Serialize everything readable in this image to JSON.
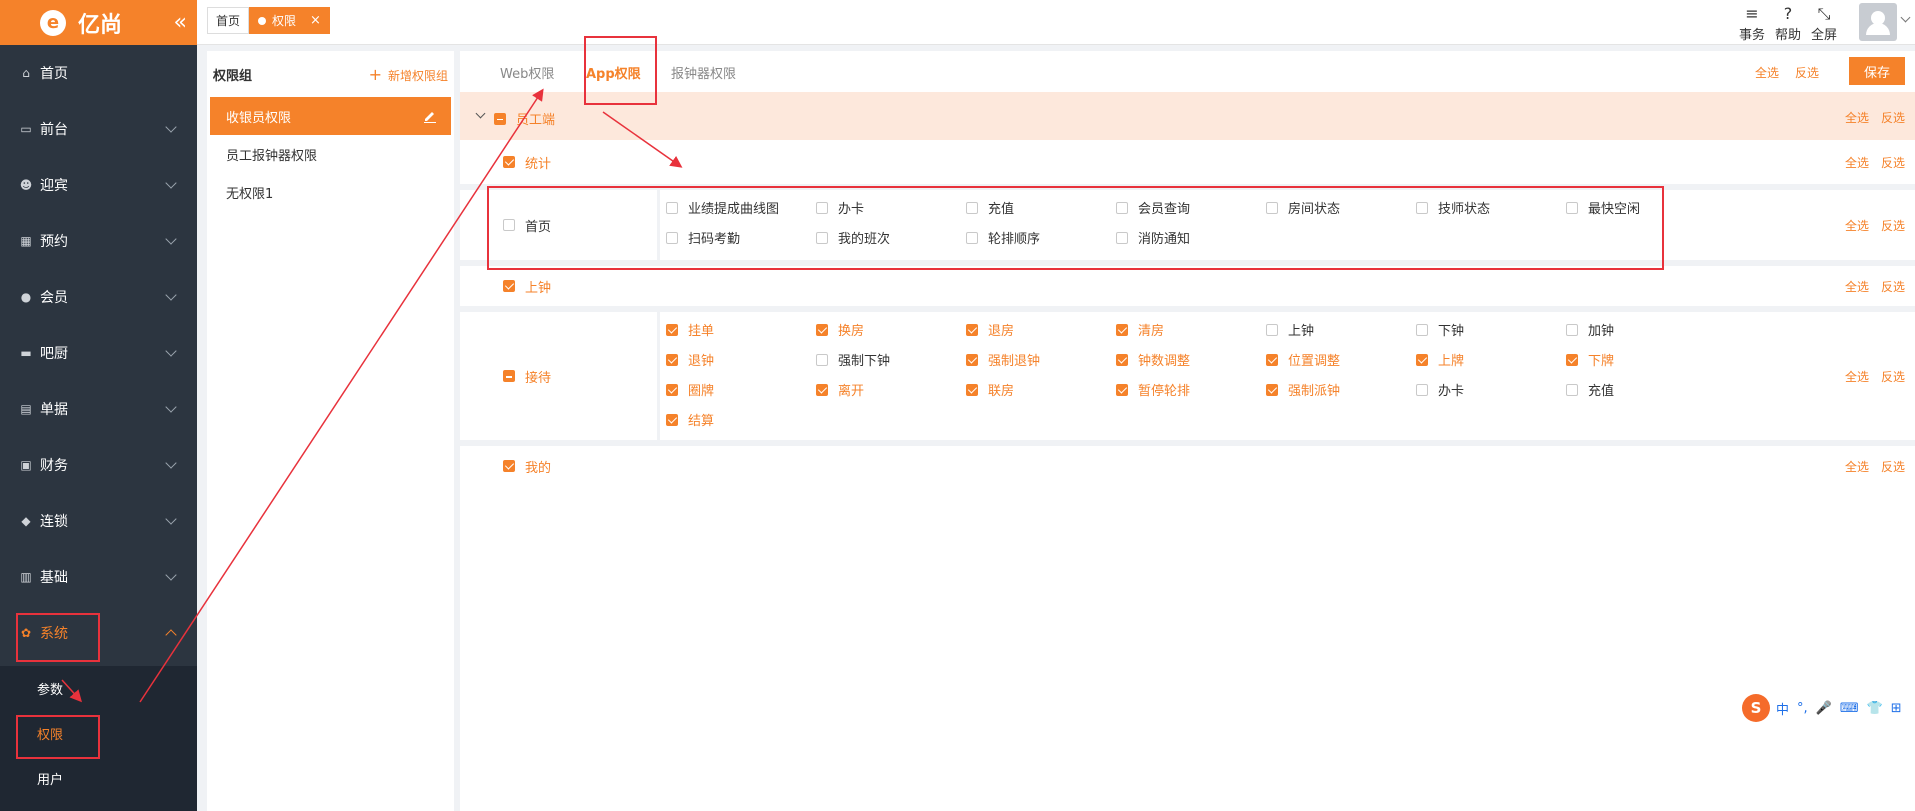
{
  "brand": {
    "name": "亿尚",
    "logo_letter": "e",
    "accent": "#f5822a"
  },
  "sidebar": {
    "items": [
      {
        "label": "首页",
        "icon": "home-icon",
        "glyph": "⌂"
      },
      {
        "label": "前台",
        "icon": "monitor-icon",
        "glyph": "▭"
      },
      {
        "label": "迎宾",
        "icon": "person-icon",
        "glyph": "☻"
      },
      {
        "label": "预约",
        "icon": "calendar-icon",
        "glyph": "▦"
      },
      {
        "label": "会员",
        "icon": "user-icon",
        "glyph": "●"
      },
      {
        "label": "吧厨",
        "icon": "bar-icon",
        "glyph": "▬"
      },
      {
        "label": "单据",
        "icon": "clipboard-icon",
        "glyph": "▤"
      },
      {
        "label": "财务",
        "icon": "finance-icon",
        "glyph": "▣"
      },
      {
        "label": "连锁",
        "icon": "cube-icon",
        "glyph": "◆"
      },
      {
        "label": "基础",
        "icon": "base-icon",
        "glyph": "▥"
      },
      {
        "label": "系统",
        "icon": "gear-icon",
        "glyph": "✿"
      }
    ],
    "sub_items": [
      {
        "label": "参数"
      },
      {
        "label": "权限"
      },
      {
        "label": "用户"
      }
    ]
  },
  "header": {
    "tabs": [
      {
        "label": "首页"
      },
      {
        "label": "权限"
      }
    ],
    "tab_close": "×",
    "buttons": [
      {
        "label": "事务",
        "icon": "menu-icon",
        "glyph": "≡"
      },
      {
        "label": "帮助",
        "icon": "help-icon",
        "glyph": "?"
      },
      {
        "label": "全屏",
        "icon": "fullscreen-icon",
        "glyph": "⤡"
      }
    ]
  },
  "groups": {
    "title": "权限组",
    "add_label": "新增权限组",
    "add_glyph": "+",
    "items": [
      {
        "label": "收银员权限"
      },
      {
        "label": "员工报钟器权限"
      },
      {
        "label": "无权限1"
      }
    ]
  },
  "permissions": {
    "tabs": [
      {
        "label": "Web权限"
      },
      {
        "label": "App权限"
      },
      {
        "label": "报钟器权限"
      }
    ],
    "select_all": "全选",
    "invert": "反选",
    "save": "保存",
    "root": {
      "label": "员工端",
      "state": "half"
    },
    "sections": [
      {
        "label": "统计",
        "checked": true,
        "options": []
      },
      {
        "label": "首页",
        "checked": false,
        "options": [
          {
            "label": "业绩提成曲线图",
            "checked": false
          },
          {
            "label": "办卡",
            "checked": false
          },
          {
            "label": "充值",
            "checked": false
          },
          {
            "label": "会员查询",
            "checked": false
          },
          {
            "label": "房间状态",
            "checked": false
          },
          {
            "label": "技师状态",
            "checked": false
          },
          {
            "label": "最快空闲",
            "checked": false
          },
          {
            "label": "扫码考勤",
            "checked": false
          },
          {
            "label": "我的班次",
            "checked": false
          },
          {
            "label": "轮排顺序",
            "checked": false
          },
          {
            "label": "消防通知",
            "checked": false
          }
        ]
      },
      {
        "label": "上钟",
        "checked": true,
        "options": []
      },
      {
        "label": "接待",
        "checked": "half",
        "options": [
          {
            "label": "挂单",
            "checked": true
          },
          {
            "label": "换房",
            "checked": true
          },
          {
            "label": "退房",
            "checked": true
          },
          {
            "label": "清房",
            "checked": true
          },
          {
            "label": "上钟",
            "checked": false
          },
          {
            "label": "下钟",
            "checked": false
          },
          {
            "label": "加钟",
            "checked": false
          },
          {
            "label": "退钟",
            "checked": true
          },
          {
            "label": "强制下钟",
            "checked": false
          },
          {
            "label": "强制退钟",
            "checked": true
          },
          {
            "label": "钟数调整",
            "checked": true
          },
          {
            "label": "位置调整",
            "checked": true
          },
          {
            "label": "上牌",
            "checked": true
          },
          {
            "label": "下牌",
            "checked": true
          },
          {
            "label": "圈牌",
            "checked": true
          },
          {
            "label": "离开",
            "checked": true
          },
          {
            "label": "联房",
            "checked": true
          },
          {
            "label": "暂停轮排",
            "checked": true
          },
          {
            "label": "强制派钟",
            "checked": true
          },
          {
            "label": "办卡",
            "checked": false
          },
          {
            "label": "充值",
            "checked": false
          },
          {
            "label": "结算",
            "checked": true
          }
        ]
      },
      {
        "label": "我的",
        "checked": true,
        "options": []
      }
    ]
  },
  "ime": {
    "logo": "S",
    "items": [
      "中",
      "°,",
      "🎤",
      "⌨",
      "👕",
      "⊞"
    ]
  }
}
